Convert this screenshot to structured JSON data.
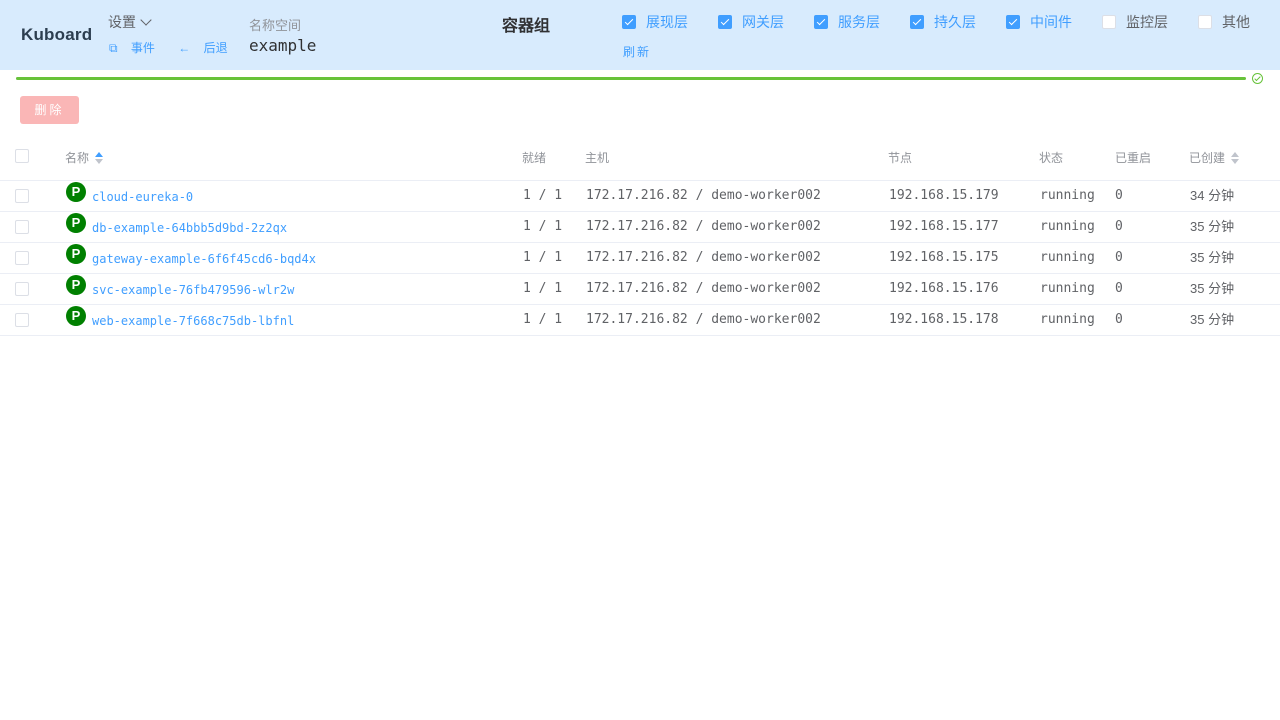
{
  "header": {
    "logo": "Kuboard",
    "settings_label": "设置",
    "events_link": "事件",
    "back_link": "后退",
    "namespace_label": "名称空间",
    "namespace_value": "example",
    "group_title": "容器组",
    "refresh_label": "刷新",
    "layers": [
      {
        "label": "展现层",
        "checked": true
      },
      {
        "label": "网关层",
        "checked": true
      },
      {
        "label": "服务层",
        "checked": true
      },
      {
        "label": "持久层",
        "checked": true
      },
      {
        "label": "中间件",
        "checked": true
      },
      {
        "label": "监控层",
        "checked": false
      },
      {
        "label": "其他",
        "checked": false
      }
    ]
  },
  "progress": {
    "percent": 100,
    "color": "#67c23a"
  },
  "toolbar": {
    "delete_label": "删除"
  },
  "table": {
    "columns": {
      "name": "名称",
      "ready": "就绪",
      "host": "主机",
      "node": "节点",
      "status": "状态",
      "restarts": "已重启",
      "created": "已创建"
    },
    "rows": [
      {
        "badge": "P",
        "name": "cloud-eureka-0",
        "ready": "1 / 1",
        "host": "172.17.216.82 / demo-worker002",
        "node": "192.168.15.179",
        "status": "running",
        "restarts": "0",
        "created": "34 分钟"
      },
      {
        "badge": "P",
        "name": "db-example-64bbb5d9bd-2z2qx",
        "ready": "1 / 1",
        "host": "172.17.216.82 / demo-worker002",
        "node": "192.168.15.177",
        "status": "running",
        "restarts": "0",
        "created": "35 分钟"
      },
      {
        "badge": "P",
        "name": "gateway-example-6f6f45cd6-bqd4x",
        "ready": "1 / 1",
        "host": "172.17.216.82 / demo-worker002",
        "node": "192.168.15.175",
        "status": "running",
        "restarts": "0",
        "created": "35 分钟"
      },
      {
        "badge": "P",
        "name": "svc-example-76fb479596-wlr2w",
        "ready": "1 / 1",
        "host": "172.17.216.82 / demo-worker002",
        "node": "192.168.15.176",
        "status": "running",
        "restarts": "0",
        "created": "35 分钟"
      },
      {
        "badge": "P",
        "name": "web-example-7f668c75db-lbfnl",
        "ready": "1 / 1",
        "host": "172.17.216.82 / demo-worker002",
        "node": "192.168.15.178",
        "status": "running",
        "restarts": "0",
        "created": "35 分钟"
      }
    ]
  }
}
